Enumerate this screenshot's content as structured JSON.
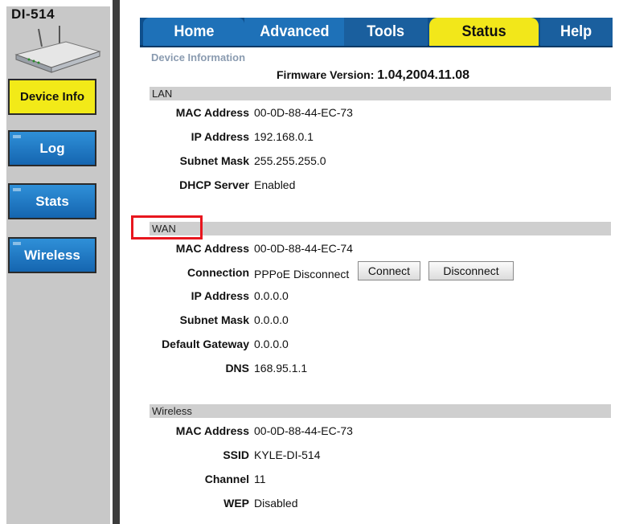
{
  "sidebar": {
    "model": "DI-514",
    "buttons": [
      {
        "label": "Device Info",
        "active": true
      },
      {
        "label": "Log",
        "active": false
      },
      {
        "label": "Stats",
        "active": false
      },
      {
        "label": "Wireless",
        "active": false
      }
    ]
  },
  "tabs": [
    {
      "label": "Home",
      "active": false
    },
    {
      "label": "Advanced",
      "active": false
    },
    {
      "label": "Tools",
      "active": false
    },
    {
      "label": "Status",
      "active": true
    },
    {
      "label": "Help",
      "active": false
    }
  ],
  "page": {
    "title": "Device Information",
    "firmware_label": "Firmware Version:",
    "firmware_value": "1.04,2004.11.08"
  },
  "lan": {
    "header": "LAN",
    "rows": [
      {
        "label": "MAC Address",
        "value": "00-0D-88-44-EC-73"
      },
      {
        "label": "IP Address",
        "value": "192.168.0.1"
      },
      {
        "label": "Subnet Mask",
        "value": "255.255.255.0"
      },
      {
        "label": "DHCP Server",
        "value": "Enabled"
      }
    ]
  },
  "wan": {
    "header": "WAN",
    "rows": [
      {
        "label": "MAC Address",
        "value": "00-0D-88-44-EC-74"
      },
      {
        "label": "Connection",
        "value": "PPPoE Disconnect"
      },
      {
        "label": "IP Address",
        "value": "0.0.0.0"
      },
      {
        "label": "Subnet Mask",
        "value": "0.0.0.0"
      },
      {
        "label": "Default Gateway",
        "value": "0.0.0.0"
      },
      {
        "label": "DNS",
        "value": "168.95.1.1"
      }
    ],
    "connect_label": "Connect",
    "disconnect_label": "Disconnect"
  },
  "wireless": {
    "header": "Wireless",
    "rows": [
      {
        "label": "MAC Address",
        "value": "00-0D-88-44-EC-73"
      },
      {
        "label": "SSID",
        "value": "KYLE-DI-514"
      },
      {
        "label": "Channel",
        "value": "11"
      },
      {
        "label": "WEP",
        "value": "Disabled"
      }
    ]
  },
  "colors": {
    "active_yellow": "#f2ea18",
    "tab_blue": "#1e71b8",
    "section_gray": "#cfcfcf",
    "highlight_red": "#e8161e"
  }
}
